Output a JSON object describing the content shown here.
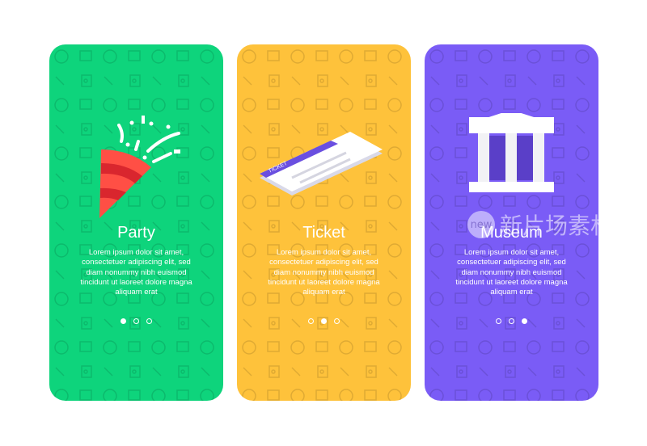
{
  "colors": {
    "party": "#0ed47c",
    "ticket": "#fec23b",
    "museum": "#7a5cf6"
  },
  "cards": [
    {
      "title": "Party",
      "icon": "party-popper-icon",
      "body": "Lorem ipsum dolor sit amet, consectetuer adipiscing elit, sed diam nonummy nibh euismod tincidunt ut laoreet dolore magna aliquam erat",
      "active_page": 1,
      "pages": 3
    },
    {
      "title": "Ticket",
      "icon": "ticket-icon",
      "ticket_label": "TICKET",
      "body": "Lorem ipsum dolor sit amet, consectetuer adipiscing elit, sed diam nonummy nibh euismod tincidunt ut laoreet dolore magna aliquam erat",
      "active_page": 2,
      "pages": 3
    },
    {
      "title": "Museum",
      "icon": "museum-icon",
      "body": "Lorem ipsum dolor sit amet, consectetuer adipiscing elit, sed diam nonummy nibh euismod tincidunt ut laoreet dolore magna aliquam erat",
      "active_page": 3,
      "pages": 3
    }
  ],
  "watermark": {
    "badge": "new",
    "text": "新片场素材"
  }
}
